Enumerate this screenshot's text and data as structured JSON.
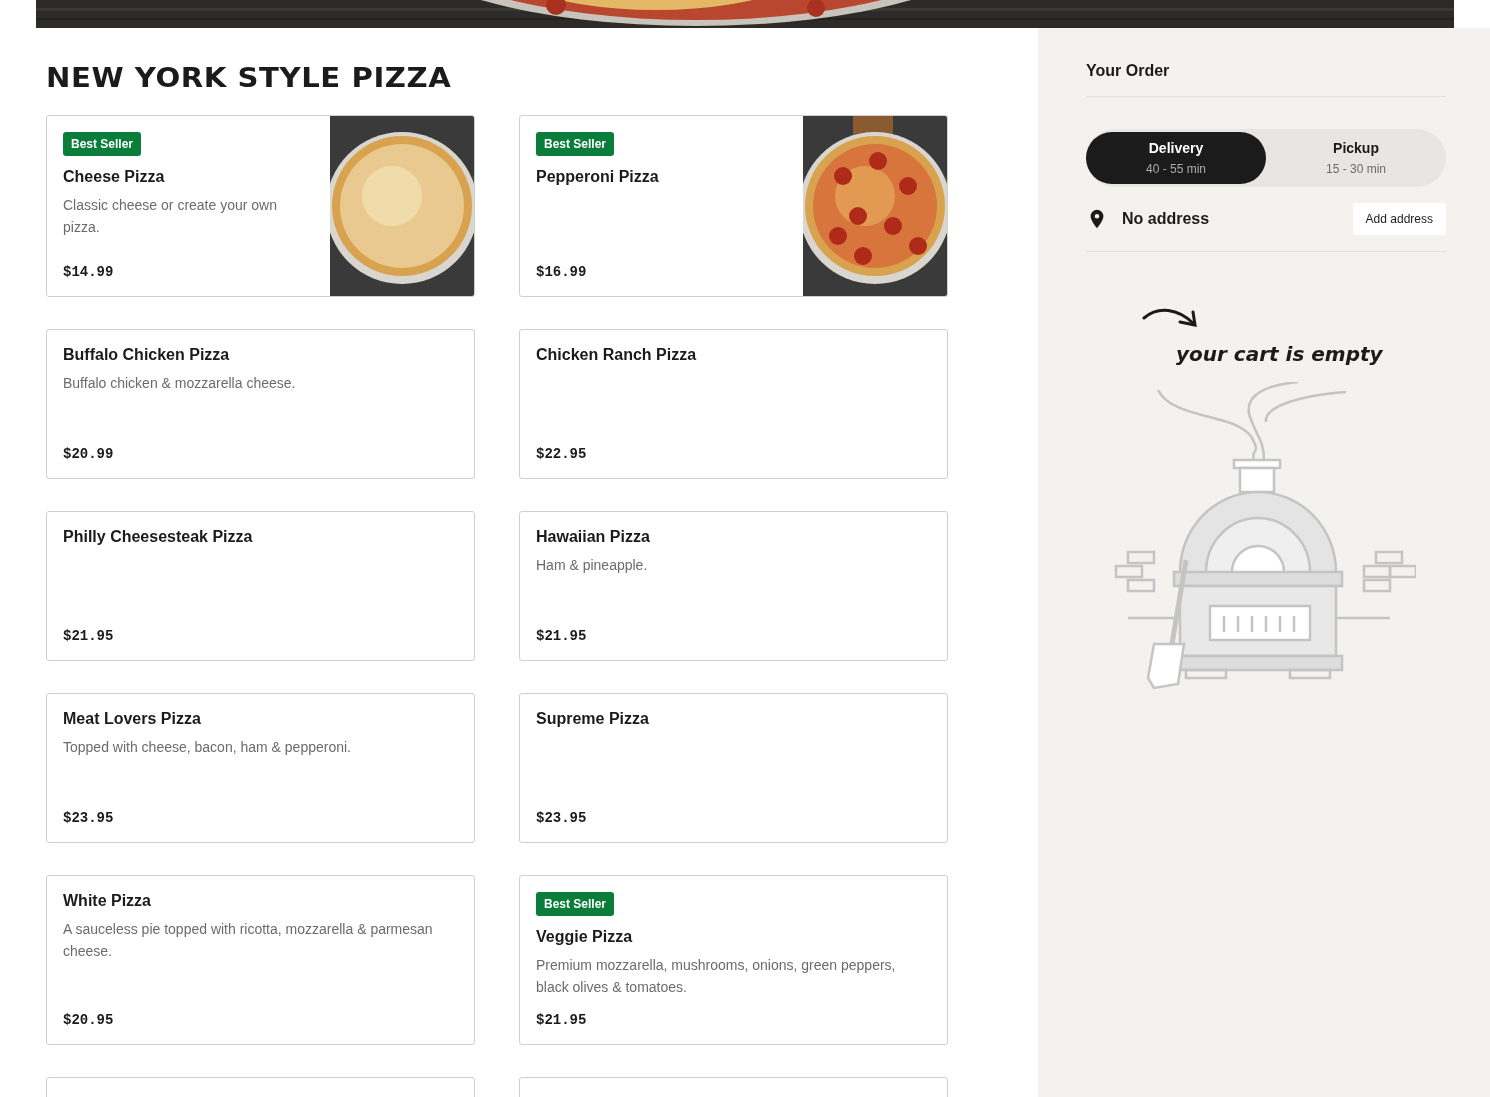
{
  "section_title": "NEW YORK STYLE PIZZA",
  "items": [
    {
      "kind": "item",
      "badge": "Best Seller",
      "name": "Cheese Pizza",
      "description": "Classic cheese or create your own pizza.",
      "price": "$14.99"
    },
    {
      "kind": "item",
      "badge": "Best Seller",
      "name": "Pepperoni Pizza",
      "price": "$16.99"
    },
    {
      "kind": "item",
      "name": "Buffalo Chicken Pizza",
      "description": "Buffalo chicken & mozzarella cheese.",
      "price": "$20.99"
    },
    {
      "kind": "item",
      "name": "Chicken Ranch Pizza",
      "price": "$22.95"
    },
    {
      "kind": "item",
      "name": "Philly Cheesesteak Pizza",
      "price": "$21.95"
    },
    {
      "kind": "item",
      "name": "Hawaiian Pizza",
      "description": "Ham & pineapple.",
      "price": "$21.95"
    },
    {
      "kind": "item",
      "name": "Meat Lovers Pizza",
      "description": "Topped with cheese, bacon, ham & pepperoni.",
      "price": "$23.95"
    },
    {
      "kind": "item",
      "name": "Supreme Pizza",
      "price": "$23.95"
    },
    {
      "kind": "item",
      "name": "White Pizza",
      "description": "A sauceless pie topped with ricotta, mozzarella & parmesan cheese.",
      "price": "$20.95"
    },
    {
      "kind": "item",
      "badge": "Best Seller",
      "name": "Veggie Pizza",
      "description": "Premium mozzarella, mushrooms, onions, green peppers, black olives & tomatoes.",
      "price": "$21.95"
    },
    {
      "kind": "cut"
    },
    {
      "kind": "cut"
    }
  ],
  "order": {
    "title": "Your Order",
    "modes": [
      {
        "label": "Delivery",
        "time": "40 - 55 min",
        "selected": true
      },
      {
        "label": "Pickup",
        "time": "15 - 30 min",
        "selected": false
      }
    ],
    "address": "No address",
    "add_address_button": "Add address",
    "empty_message": "your cart is empty"
  }
}
